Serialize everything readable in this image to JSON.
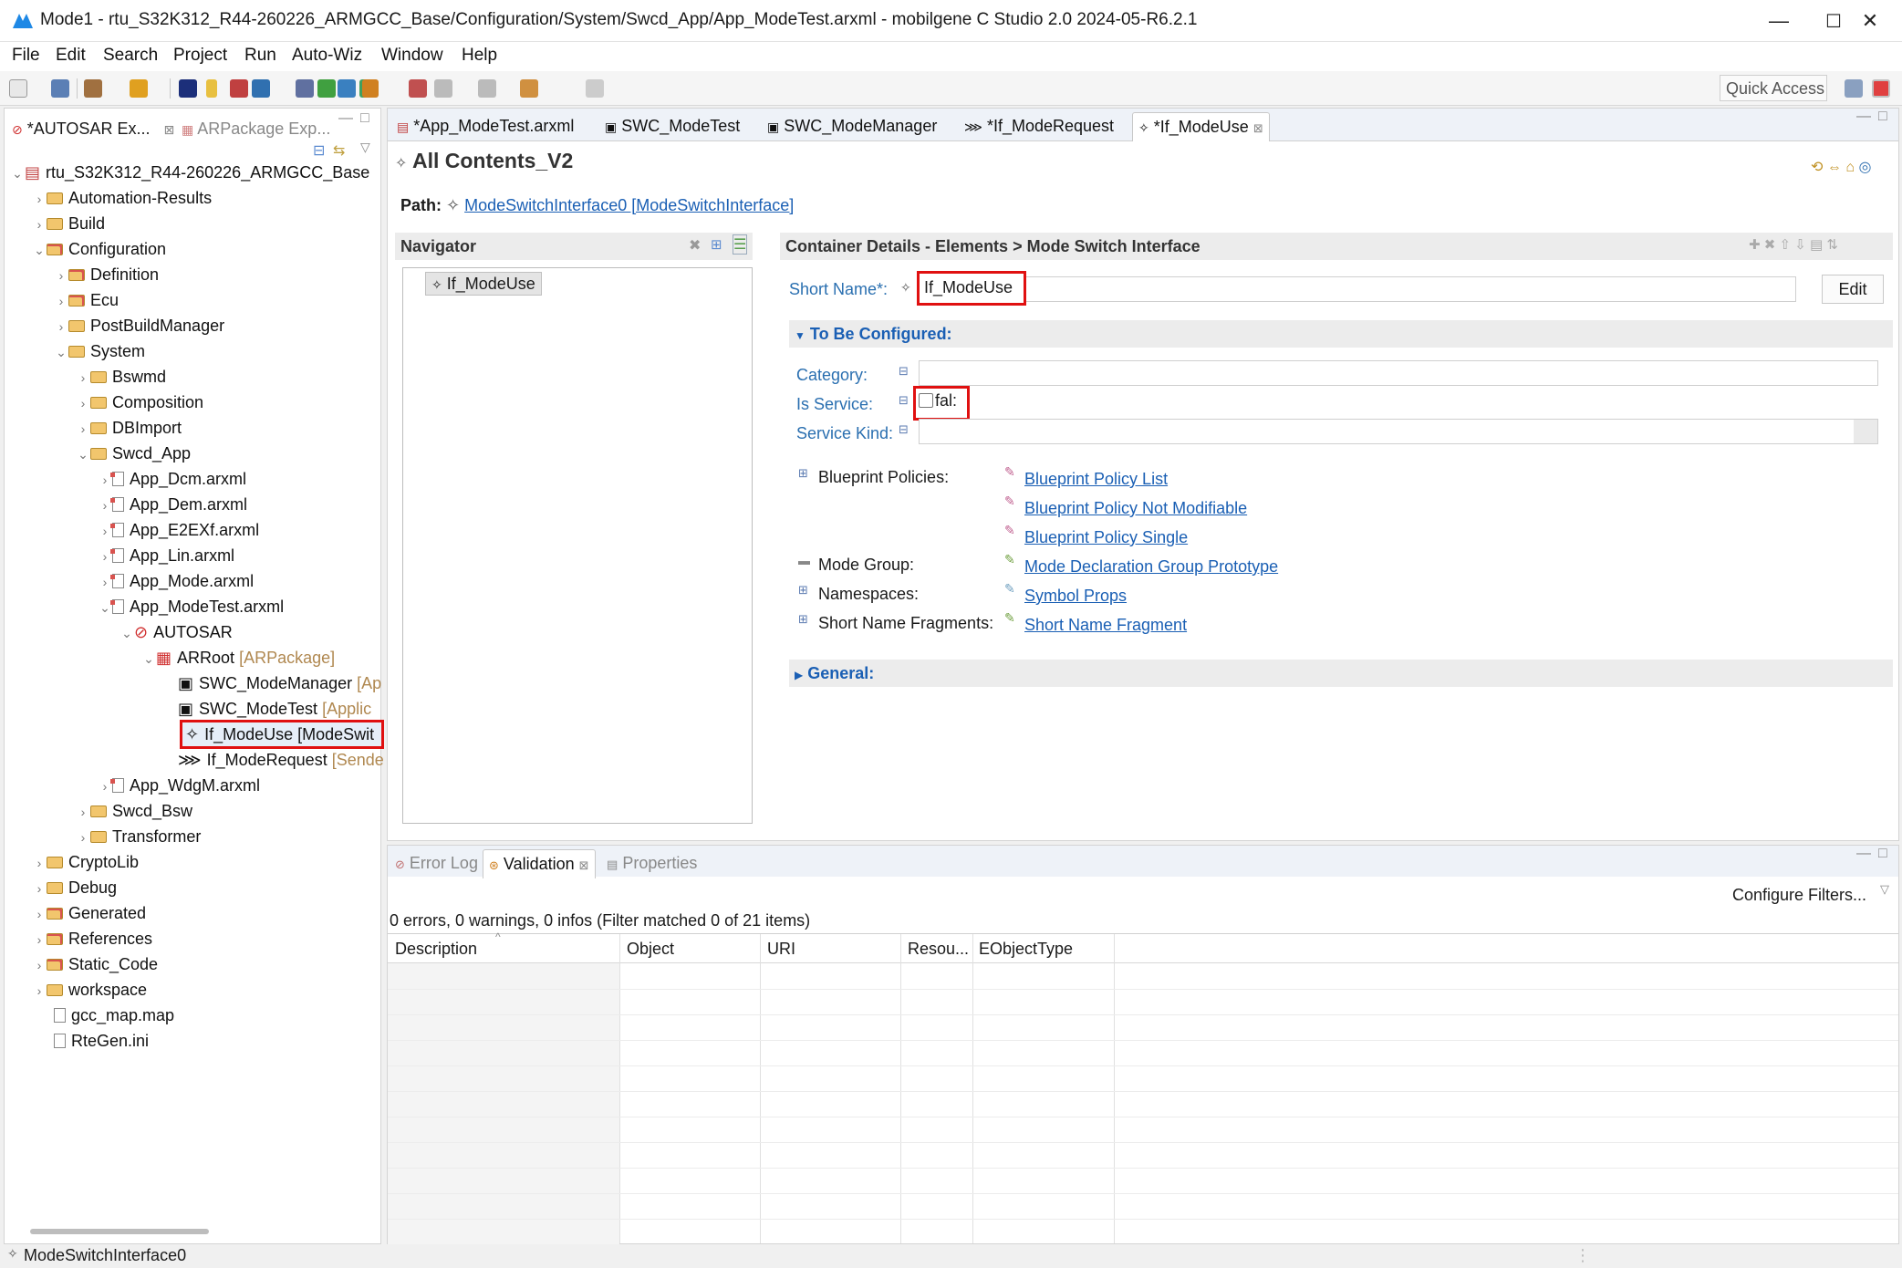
{
  "window": {
    "title": "Mode1 - rtu_S32K312_R44-260226_ARMGCC_Base/Configuration/System/Swcd_App/App_ModeTest.arxml - mobilgene C Studio 2.0 2024-05-R6.2.1",
    "minimize": "—",
    "maximize": "☐",
    "close": "✕"
  },
  "menu": [
    "File",
    "Edit",
    "Search",
    "Project",
    "Run",
    "Auto-Wiz",
    "Window",
    "Help"
  ],
  "toolbar": {
    "quick_access": "Quick Access"
  },
  "left_panel": {
    "tabs": [
      "*AUTOSAR Ex...",
      "ARPackage Exp..."
    ],
    "tree": [
      {
        "label": "rtu_S32K312_R44-260226_ARMGCC_Base",
        "suffix": ""
      },
      {
        "label": "Automation-Results",
        "suffix": ""
      },
      {
        "label": "Build",
        "suffix": ""
      },
      {
        "label": "Configuration",
        "suffix": ""
      },
      {
        "label": "Definition",
        "suffix": ""
      },
      {
        "label": "Ecu",
        "suffix": ""
      },
      {
        "label": "PostBuildManager",
        "suffix": ""
      },
      {
        "label": "System",
        "suffix": ""
      },
      {
        "label": "Bswmd",
        "suffix": ""
      },
      {
        "label": "Composition",
        "suffix": ""
      },
      {
        "label": "DBImport",
        "suffix": ""
      },
      {
        "label": "Swcd_App",
        "suffix": ""
      },
      {
        "label": "App_Dcm.arxml",
        "suffix": ""
      },
      {
        "label": "App_Dem.arxml",
        "suffix": ""
      },
      {
        "label": "App_E2EXf.arxml",
        "suffix": ""
      },
      {
        "label": "App_Lin.arxml",
        "suffix": ""
      },
      {
        "label": "App_Mode.arxml",
        "suffix": ""
      },
      {
        "label": "App_ModeTest.arxml",
        "suffix": ""
      },
      {
        "label": "AUTOSAR",
        "suffix": ""
      },
      {
        "label": "ARRoot",
        "suffix": "[ARPackage]"
      },
      {
        "label": "SWC_ModeManager",
        "suffix": "[Ap"
      },
      {
        "label": "SWC_ModeTest",
        "suffix": "[Applic"
      },
      {
        "label": "If_ModeUse [ModeSwit",
        "suffix": ""
      },
      {
        "label": "If_ModeRequest",
        "suffix": "[Sende"
      },
      {
        "label": "App_WdgM.arxml",
        "suffix": ""
      },
      {
        "label": "Swcd_Bsw",
        "suffix": ""
      },
      {
        "label": "Transformer",
        "suffix": ""
      },
      {
        "label": "CryptoLib",
        "suffix": ""
      },
      {
        "label": "Debug",
        "suffix": ""
      },
      {
        "label": "Generated",
        "suffix": ""
      },
      {
        "label": "References",
        "suffix": ""
      },
      {
        "label": "Static_Code",
        "suffix": ""
      },
      {
        "label": "workspace",
        "suffix": ""
      },
      {
        "label": "gcc_map.map",
        "suffix": ""
      },
      {
        "label": "RteGen.ini",
        "suffix": ""
      }
    ]
  },
  "editor": {
    "tabs": [
      "*App_ModeTest.arxml",
      "SWC_ModeTest",
      "SWC_ModeManager",
      "*If_ModeRequest",
      "*If_ModeUse"
    ],
    "heading": "All Contents_V2",
    "path_label": "Path:",
    "path_value": "ModeSwitchInterface0 [ModeSwitchInterface]",
    "navigator_title": "Navigator",
    "navigator_item": "If_ModeUse",
    "details_title": "Container Details - Elements > Mode Switch Interface",
    "short_name_label": "Short Name*:",
    "short_name_value": "If_ModeUse",
    "edit_button": "Edit",
    "to_be_configured": "To Be Configured:",
    "category_label": "Category:",
    "is_service_label": "Is Service:",
    "is_service_value": "fal:",
    "service_kind_label": "Service Kind:",
    "blueprint_label": "Blueprint Policies:",
    "blueprint_links": [
      "Blueprint Policy List",
      "Blueprint Policy Not Modifiable",
      "Blueprint Policy Single"
    ],
    "mode_group_label": "Mode Group:",
    "mode_group_link": "Mode Declaration Group Prototype",
    "namespaces_label": "Namespaces:",
    "namespaces_link": "Symbol Props",
    "snf_label": "Short Name Fragments:",
    "snf_link": "Short Name Fragment",
    "general": "General:"
  },
  "bottom": {
    "tabs": [
      "Error Log",
      "Validation",
      "Properties"
    ],
    "configure_filters": "Configure Filters...",
    "summary": "0 errors, 0 warnings, 0 infos (Filter matched 0 of 21 items)",
    "columns": [
      "Description",
      "Object",
      "URI",
      "Resou...",
      "EObjectType"
    ]
  },
  "status": {
    "text": "ModeSwitchInterface0"
  },
  "colors": {
    "accent": "#1a5fb4",
    "highlight": "#e01010",
    "folder": "#f2c66d"
  }
}
